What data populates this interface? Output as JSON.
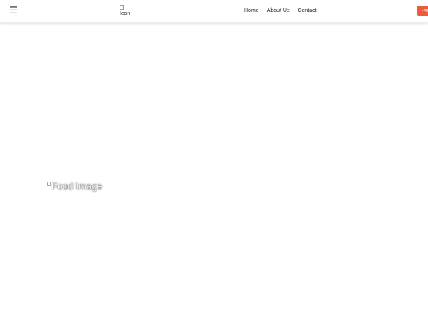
{
  "navbar": {
    "menu_icon": "☰",
    "logo_alt": "Icon",
    "links": [
      "Home",
      "About Us",
      "Contact"
    ],
    "login_label": "Log",
    "login_color": "#f05a3c"
  },
  "hero": {
    "image_alt": "Food Image"
  }
}
